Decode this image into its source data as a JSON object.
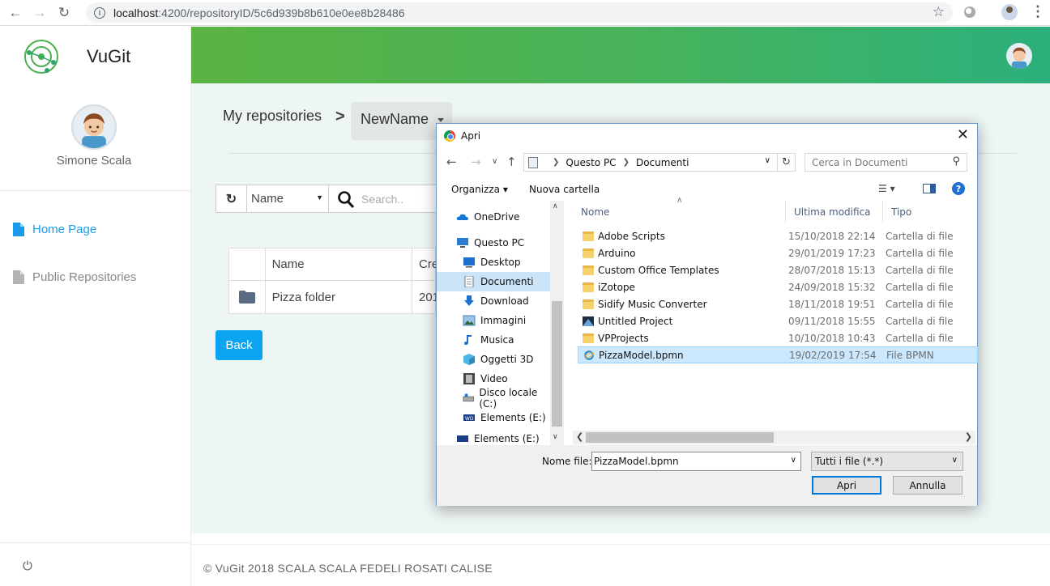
{
  "browser": {
    "url_host": "localhost",
    "url_path": ":4200/repositoryID/5c6d939b8b610e0ee8b28486"
  },
  "sidebar": {
    "brand": "VuGit",
    "user_name": "Simone Scala",
    "items": [
      {
        "label": "Home Page",
        "icon": "document-icon",
        "active": true
      },
      {
        "label": "Public Repositories",
        "icon": "document-icon",
        "active": false
      }
    ]
  },
  "breadcrumb": {
    "root": "My repositories",
    "separator": ">",
    "current": "NewName"
  },
  "toolbar": {
    "sort_value": "Name",
    "search_placeholder": "Search.."
  },
  "table": {
    "headers": [
      "Name",
      "Cre"
    ],
    "rows": [
      {
        "name": "Pizza folder",
        "created": "201"
      }
    ]
  },
  "back_label": "Back",
  "footer": "© VuGit 2018 SCALA SCALA FEDELI ROSATI CALISE",
  "dialog": {
    "title": "Apri",
    "path": [
      "Questo PC",
      "Documenti"
    ],
    "search_placeholder": "Cerca in Documenti",
    "organize": "Organizza",
    "new_folder": "Nuova cartella",
    "nav": [
      {
        "label": "OneDrive",
        "icon": "cloud-icon"
      },
      {
        "label": "Questo PC",
        "icon": "computer-icon"
      },
      {
        "label": "Desktop",
        "icon": "desktop-icon"
      },
      {
        "label": "Documenti",
        "icon": "document-icon",
        "selected": true
      },
      {
        "label": "Download",
        "icon": "download-icon"
      },
      {
        "label": "Immagini",
        "icon": "pictures-icon"
      },
      {
        "label": "Musica",
        "icon": "music-icon"
      },
      {
        "label": "Oggetti 3D",
        "icon": "cube-icon"
      },
      {
        "label": "Video",
        "icon": "video-icon"
      },
      {
        "label": "Disco locale (C:)",
        "icon": "drive-icon"
      },
      {
        "label": "Elements (E:)",
        "icon": "external-drive-icon"
      },
      {
        "label": "Elements (E:)",
        "icon": "external-drive-icon"
      }
    ],
    "columns": [
      "Nome",
      "Ultima modifica",
      "Tipo"
    ],
    "files": [
      {
        "name": "Adobe Scripts",
        "date": "15/10/2018 22:14",
        "type": "Cartella di file",
        "icon": "folder-icon"
      },
      {
        "name": "Arduino",
        "date": "29/01/2019 17:23",
        "type": "Cartella di file",
        "icon": "folder-icon"
      },
      {
        "name": "Custom Office Templates",
        "date": "28/07/2018 15:13",
        "type": "Cartella di file",
        "icon": "folder-icon"
      },
      {
        "name": "iZotope",
        "date": "24/09/2018 15:32",
        "type": "Cartella di file",
        "icon": "folder-icon"
      },
      {
        "name": "Sidify Music Converter",
        "date": "18/11/2018 19:51",
        "type": "Cartella di file",
        "icon": "folder-icon"
      },
      {
        "name": "Untitled Project",
        "date": "09/11/2018 15:55",
        "type": "Cartella di file",
        "icon": "project-icon"
      },
      {
        "name": "VPProjects",
        "date": "10/10/2018 10:43",
        "type": "Cartella di file",
        "icon": "folder-icon"
      },
      {
        "name": "PizzaModel.bpmn",
        "date": "19/02/2019 17:54",
        "type": "File BPMN",
        "icon": "ie-file-icon",
        "selected": true
      }
    ],
    "filename_label": "Nome file:",
    "filename_value": "PizzaModel.bpmn",
    "filetype_value": "Tutti i file (*.*)",
    "open_label": "Apri",
    "cancel_label": "Annulla"
  }
}
